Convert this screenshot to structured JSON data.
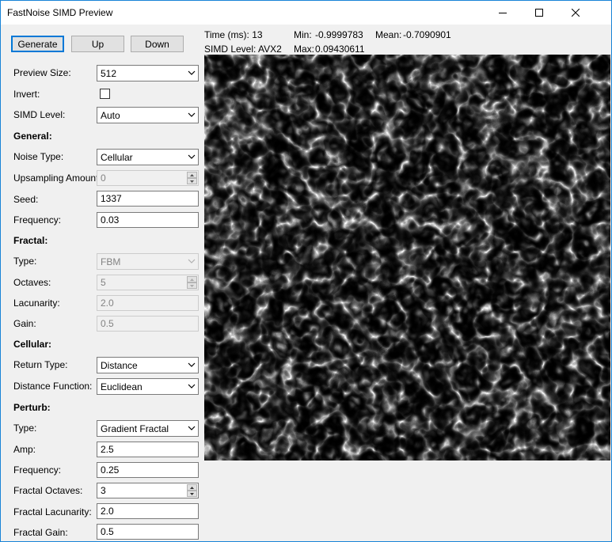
{
  "window": {
    "title": "FastNoise SIMD Preview"
  },
  "toolbar": {
    "generate_label": "Generate",
    "up_label": "Up",
    "down_label": "Down"
  },
  "stats": {
    "time_label": "Time (ms): 13",
    "min_label": "Min:",
    "min_value": "-0.9999783",
    "mean_label": "Mean:",
    "mean_value": "-0.7090901",
    "simd_label": "SIMD Level: AVX2",
    "max_label": "Max:",
    "max_value": "0.09430611"
  },
  "settings": {
    "preview_size": {
      "label": "Preview Size:",
      "value": "512"
    },
    "invert": {
      "label": "Invert:",
      "checked": false
    },
    "simd_level": {
      "label": "SIMD Level:",
      "value": "Auto"
    },
    "general": {
      "heading": "General:",
      "noise_type": {
        "label": "Noise Type:",
        "value": "Cellular"
      },
      "upsampling": {
        "label": "Upsampling Amount:",
        "value": "0"
      },
      "seed": {
        "label": "Seed:",
        "value": "1337"
      },
      "frequency": {
        "label": "Frequency:",
        "value": "0.03"
      }
    },
    "fractal": {
      "heading": "Fractal:",
      "type": {
        "label": "Type:",
        "value": "FBM"
      },
      "octaves": {
        "label": "Octaves:",
        "value": "5"
      },
      "lacunarity": {
        "label": "Lacunarity:",
        "value": "2.0"
      },
      "gain": {
        "label": "Gain:",
        "value": "0.5"
      }
    },
    "cellular": {
      "heading": "Cellular:",
      "return_type": {
        "label": "Return Type:",
        "value": "Distance"
      },
      "distance_function": {
        "label": "Distance Function:",
        "value": "Euclidean"
      }
    },
    "perturb": {
      "heading": "Perturb:",
      "type": {
        "label": "Type:",
        "value": "Gradient Fractal"
      },
      "amp": {
        "label": "Amp:",
        "value": "2.5"
      },
      "frequency": {
        "label": "Frequency:",
        "value": "0.25"
      },
      "fractal_octaves": {
        "label": "Fractal Octaves:",
        "value": "3"
      },
      "fractal_lacunarity": {
        "label": "Fractal Lacunarity:",
        "value": "2.0"
      },
      "fractal_gain": {
        "label": "Fractal Gain:",
        "value": "0.5"
      }
    }
  },
  "colors": {
    "accent": "#0078d7",
    "window_border": "#1883d7",
    "panel_bg": "#f0f0f0"
  },
  "icons": [
    "minimize-icon",
    "maximize-icon",
    "close-icon",
    "chevron-down-icon",
    "spin-up-icon",
    "spin-down-icon"
  ]
}
